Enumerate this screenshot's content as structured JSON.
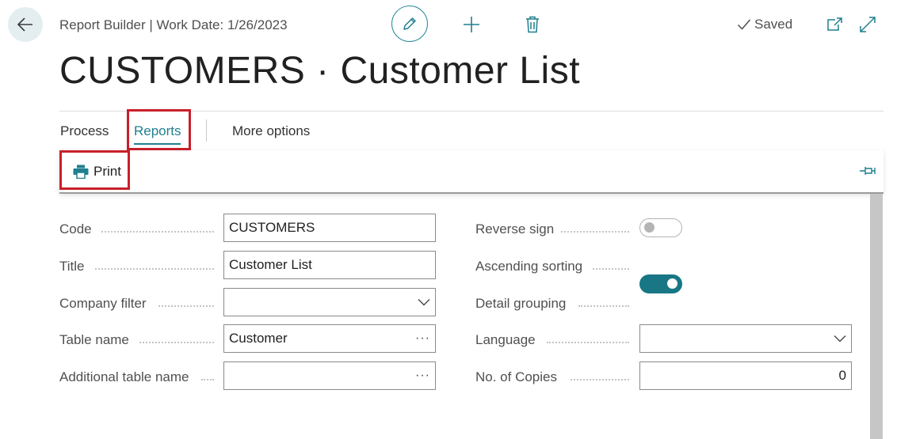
{
  "header": {
    "breadcrumb": "Report Builder | Work Date: 1/26/2023",
    "saved_label": "Saved",
    "title": "CUSTOMERS · Customer List"
  },
  "tabs": {
    "process": "Process",
    "reports": "Reports",
    "more": "More options"
  },
  "actions": {
    "print": "Print"
  },
  "form_left": {
    "code_label": "Code",
    "code_value": "CUSTOMERS",
    "title_label": "Title",
    "title_value": "Customer List",
    "company_filter_label": "Company filter",
    "company_filter_value": "",
    "table_name_label": "Table name",
    "table_name_value": "Customer",
    "additional_table_label": "Additional table name",
    "additional_table_value": ""
  },
  "form_right": {
    "reverse_sign_label": "Reverse sign",
    "reverse_sign": false,
    "ascending_label": "Ascending sorting",
    "ascending": true,
    "detail_grouping_label": "Detail grouping",
    "detail_grouping": false,
    "language_label": "Language",
    "language_value": "",
    "copies_label": "No. of Copies",
    "copies_value": "0"
  },
  "colors": {
    "accent": "#1f7f8f",
    "highlight": "#c8202a"
  }
}
